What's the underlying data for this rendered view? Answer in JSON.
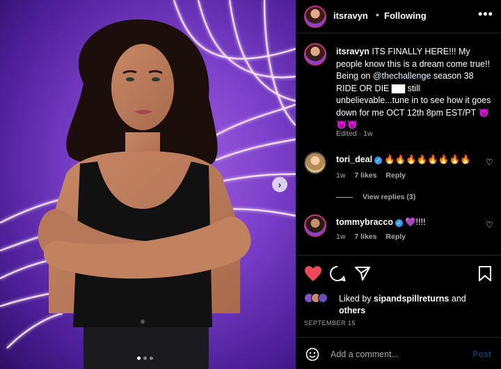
{
  "post": {
    "username": "itsravyn",
    "separator": "•",
    "follow_status": "Following",
    "more_label": "•••",
    "caption_user": "itsravyn",
    "caption_text_1": " ITS FINALLY HERE!!! My people know this is a dream come true!! Being on ",
    "caption_mention": "@thechallenge",
    "caption_text_2": " season 38 RIDE OR DIE ▇▇ still unbelievable...tune in to see how it goes down for me OCT 12th 8pm EST/PT 😈😈😈",
    "edited": "Edited",
    "edited_sep": " · ",
    "edited_time": "1w"
  },
  "comments": [
    {
      "user": "tori_deal",
      "text": "🔥🔥🔥🔥🔥🔥🔥🔥",
      "time": "1w",
      "likes": "7 likes",
      "reply": "Reply",
      "verified": true
    },
    {
      "user": "tommybracco",
      "text": "💜!!!!",
      "time": "1w",
      "likes": "7 likes",
      "reply": "Reply",
      "verified": true
    }
  ],
  "view_replies": "View replies (3)",
  "likes": {
    "prefix": "Liked by ",
    "user": "sipandspillreturns",
    "mid": " and",
    "suffix": "others"
  },
  "date": "SEPTEMBER 15",
  "add_comment": {
    "placeholder": "Add a comment...",
    "post_label": "Post"
  },
  "carousel": {
    "dots": 3,
    "active": 0,
    "next_icon": "›"
  },
  "colors": {
    "heart": "#ed4956",
    "verified": "#3897f0",
    "background": "#000000",
    "photo_purple": "#7a3fc9"
  },
  "icons": [
    "heart-icon",
    "comment-icon",
    "share-icon",
    "bookmark-icon",
    "emoji-icon",
    "chevron-right-icon"
  ]
}
